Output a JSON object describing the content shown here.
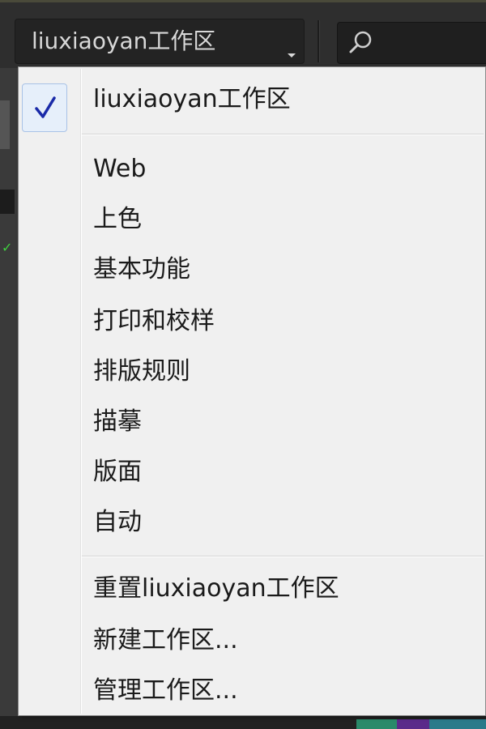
{
  "toolbar": {
    "workspace_label": "liuxiaoyan工作区",
    "search_placeholder": ""
  },
  "menu": {
    "current": {
      "label": "liuxiaoyan工作区",
      "checked": true
    },
    "workspaces": [
      {
        "label": "Web"
      },
      {
        "label": "上色"
      },
      {
        "label": "基本功能"
      },
      {
        "label": "打印和校样"
      },
      {
        "label": "排版规则"
      },
      {
        "label": "描摹"
      },
      {
        "label": "版面"
      },
      {
        "label": "自动"
      }
    ],
    "actions": [
      {
        "label": "重置liuxiaoyan工作区"
      },
      {
        "label": "新建工作区..."
      },
      {
        "label": "管理工作区..."
      }
    ]
  },
  "colors": {
    "menu_bg": "#f0f0f0",
    "toolbar_bg": "#2e2e2e",
    "check_color": "#1a2aa8"
  }
}
